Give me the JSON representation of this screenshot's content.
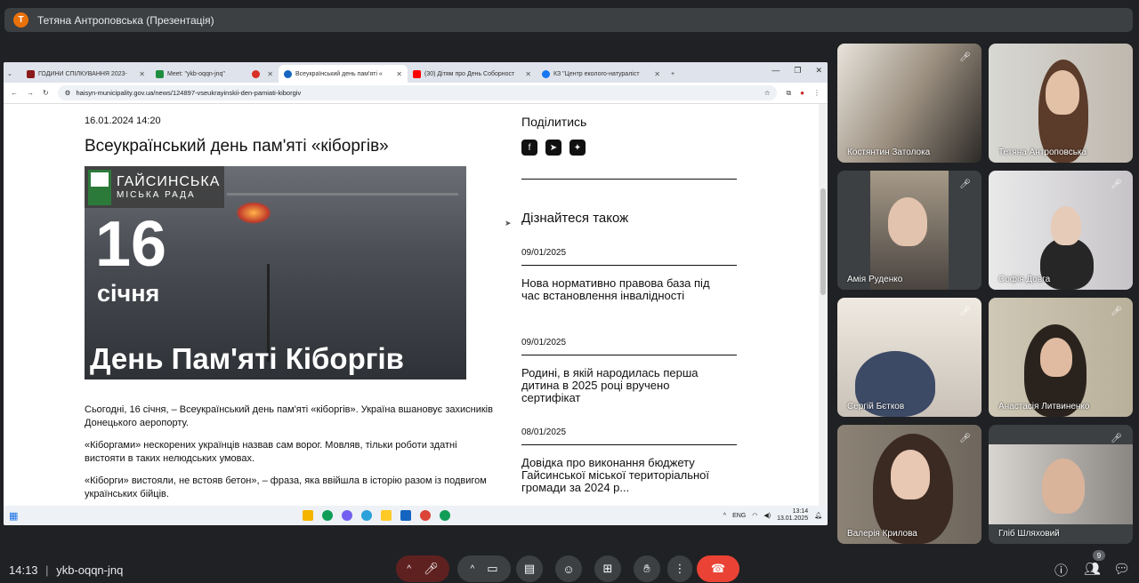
{
  "meet": {
    "presenter_banner": "Тетяна Антроповська (Презентація)",
    "presenter_initial": "Т",
    "time": "14:13",
    "separator": "|",
    "code": "ykb-oqqn-jnq",
    "participant_count": "9"
  },
  "browser": {
    "tabs": [
      {
        "label": "ГОДИНИ СПІЛКУВАННЯ 2023-",
        "color": "#8b1a1a"
      },
      {
        "label": "Meet: \"ykb-oqqn-jnq\"",
        "color": "#1e8e3e"
      },
      {
        "label": "",
        "color": "#d93025"
      },
      {
        "label": "Всеукраїнський день пам'яті «",
        "color": "#1565c0"
      },
      {
        "label": "(30) Дітям про День Соборност",
        "color": "#ff0000"
      },
      {
        "label": "КЗ \"Центр еколого-натураліст",
        "color": "#1877f2"
      }
    ],
    "url": "haisyn-municipality.gov.ua/news/124897-vseukrayinskii-den-pamiati-kiborgiv"
  },
  "article": {
    "date": "16.01.2024 14:20",
    "title": "Всеукраїнський день пам'яті «кіборгів»",
    "hero": {
      "logo_line1": "ГАЙСИНСЬКА",
      "logo_line2": "МІСЬКА РАДА",
      "big_number": "16",
      "month": "січня",
      "caption": "День Пам'яті Кіборгів"
    },
    "paragraphs": [
      "Сьогодні, 16 січня, – Всеукраїнський день пам'яті «кіборгів». Україна вшановує захисників Донецького аеропорту.",
      "«Кіборгами» нескорених українців назвав сам ворог. Мовляв, тільки роботи здатні вистояти в таких нелюдських умовах.",
      "«Кіборги» вистояли, не встояв бетон», – фраза, яка ввійшла в історію разом із подвигом українських бійців."
    ]
  },
  "sidebar": {
    "share_label": "Поділитись",
    "also_label": "Дізнайтеся також",
    "news": [
      {
        "date": "09/01/2025",
        "title": "Нова нормативно правова база під час встановлення інвалідності"
      },
      {
        "date": "09/01/2025",
        "title": "Родині, в якій народилась перша дитина в 2025 році вручено сертифікат"
      },
      {
        "date": "08/01/2025",
        "title": "Довідка про виконання бюджету Гайсинської міської територіальної громади за 2024 р..."
      }
    ]
  },
  "taskbar": {
    "lang": "ENG",
    "time": "13:14",
    "date": "13.01.2025"
  },
  "participants": [
    {
      "name": "Костянтин Затолока",
      "muted": true
    },
    {
      "name": "Тетяна Антроповська",
      "muted": false
    },
    {
      "name": "Амія Руденко",
      "muted": true
    },
    {
      "name": "Софія Довга",
      "muted": true
    },
    {
      "name": "Сергій Бєтков",
      "muted": true
    },
    {
      "name": "Анастасія Литвиненко",
      "muted": true
    },
    {
      "name": "Валерія Крилова",
      "muted": true
    },
    {
      "name": "Гліб Шляховий",
      "muted": true
    }
  ]
}
